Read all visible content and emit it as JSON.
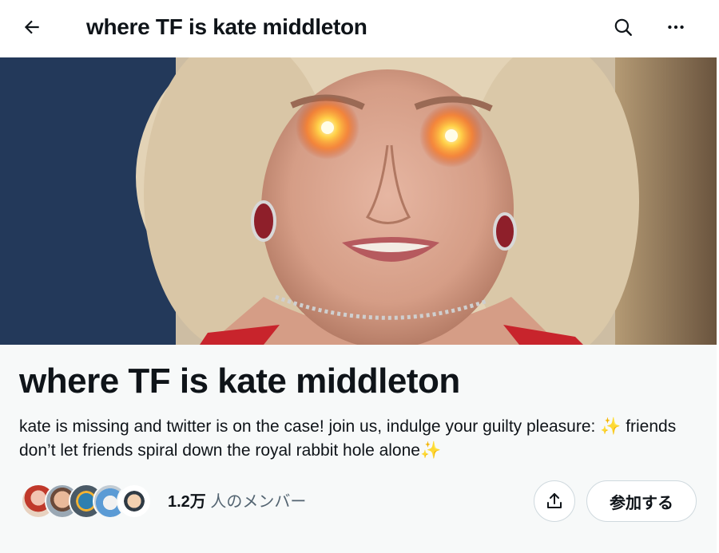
{
  "header": {
    "title": "where TF is kate middleton",
    "back_icon": "arrow-left-icon",
    "search_icon": "search-icon",
    "more_icon": "more-horizontal-icon"
  },
  "community": {
    "title": "where TF is kate middleton",
    "description": "kate is missing and twitter is on the case! join us, indulge your guilty pleasure: ✨ friends don’t let friends spiral down the royal rabbit hole alone✨",
    "member_count": "1.2万",
    "member_label": " 人のメンバー",
    "join_label": "参加する",
    "share_icon": "share-icon"
  },
  "colors": {
    "text_primary": "#0f1419",
    "text_secondary": "#536471",
    "border": "#cfd9de",
    "info_background": "#f7f9f9"
  }
}
